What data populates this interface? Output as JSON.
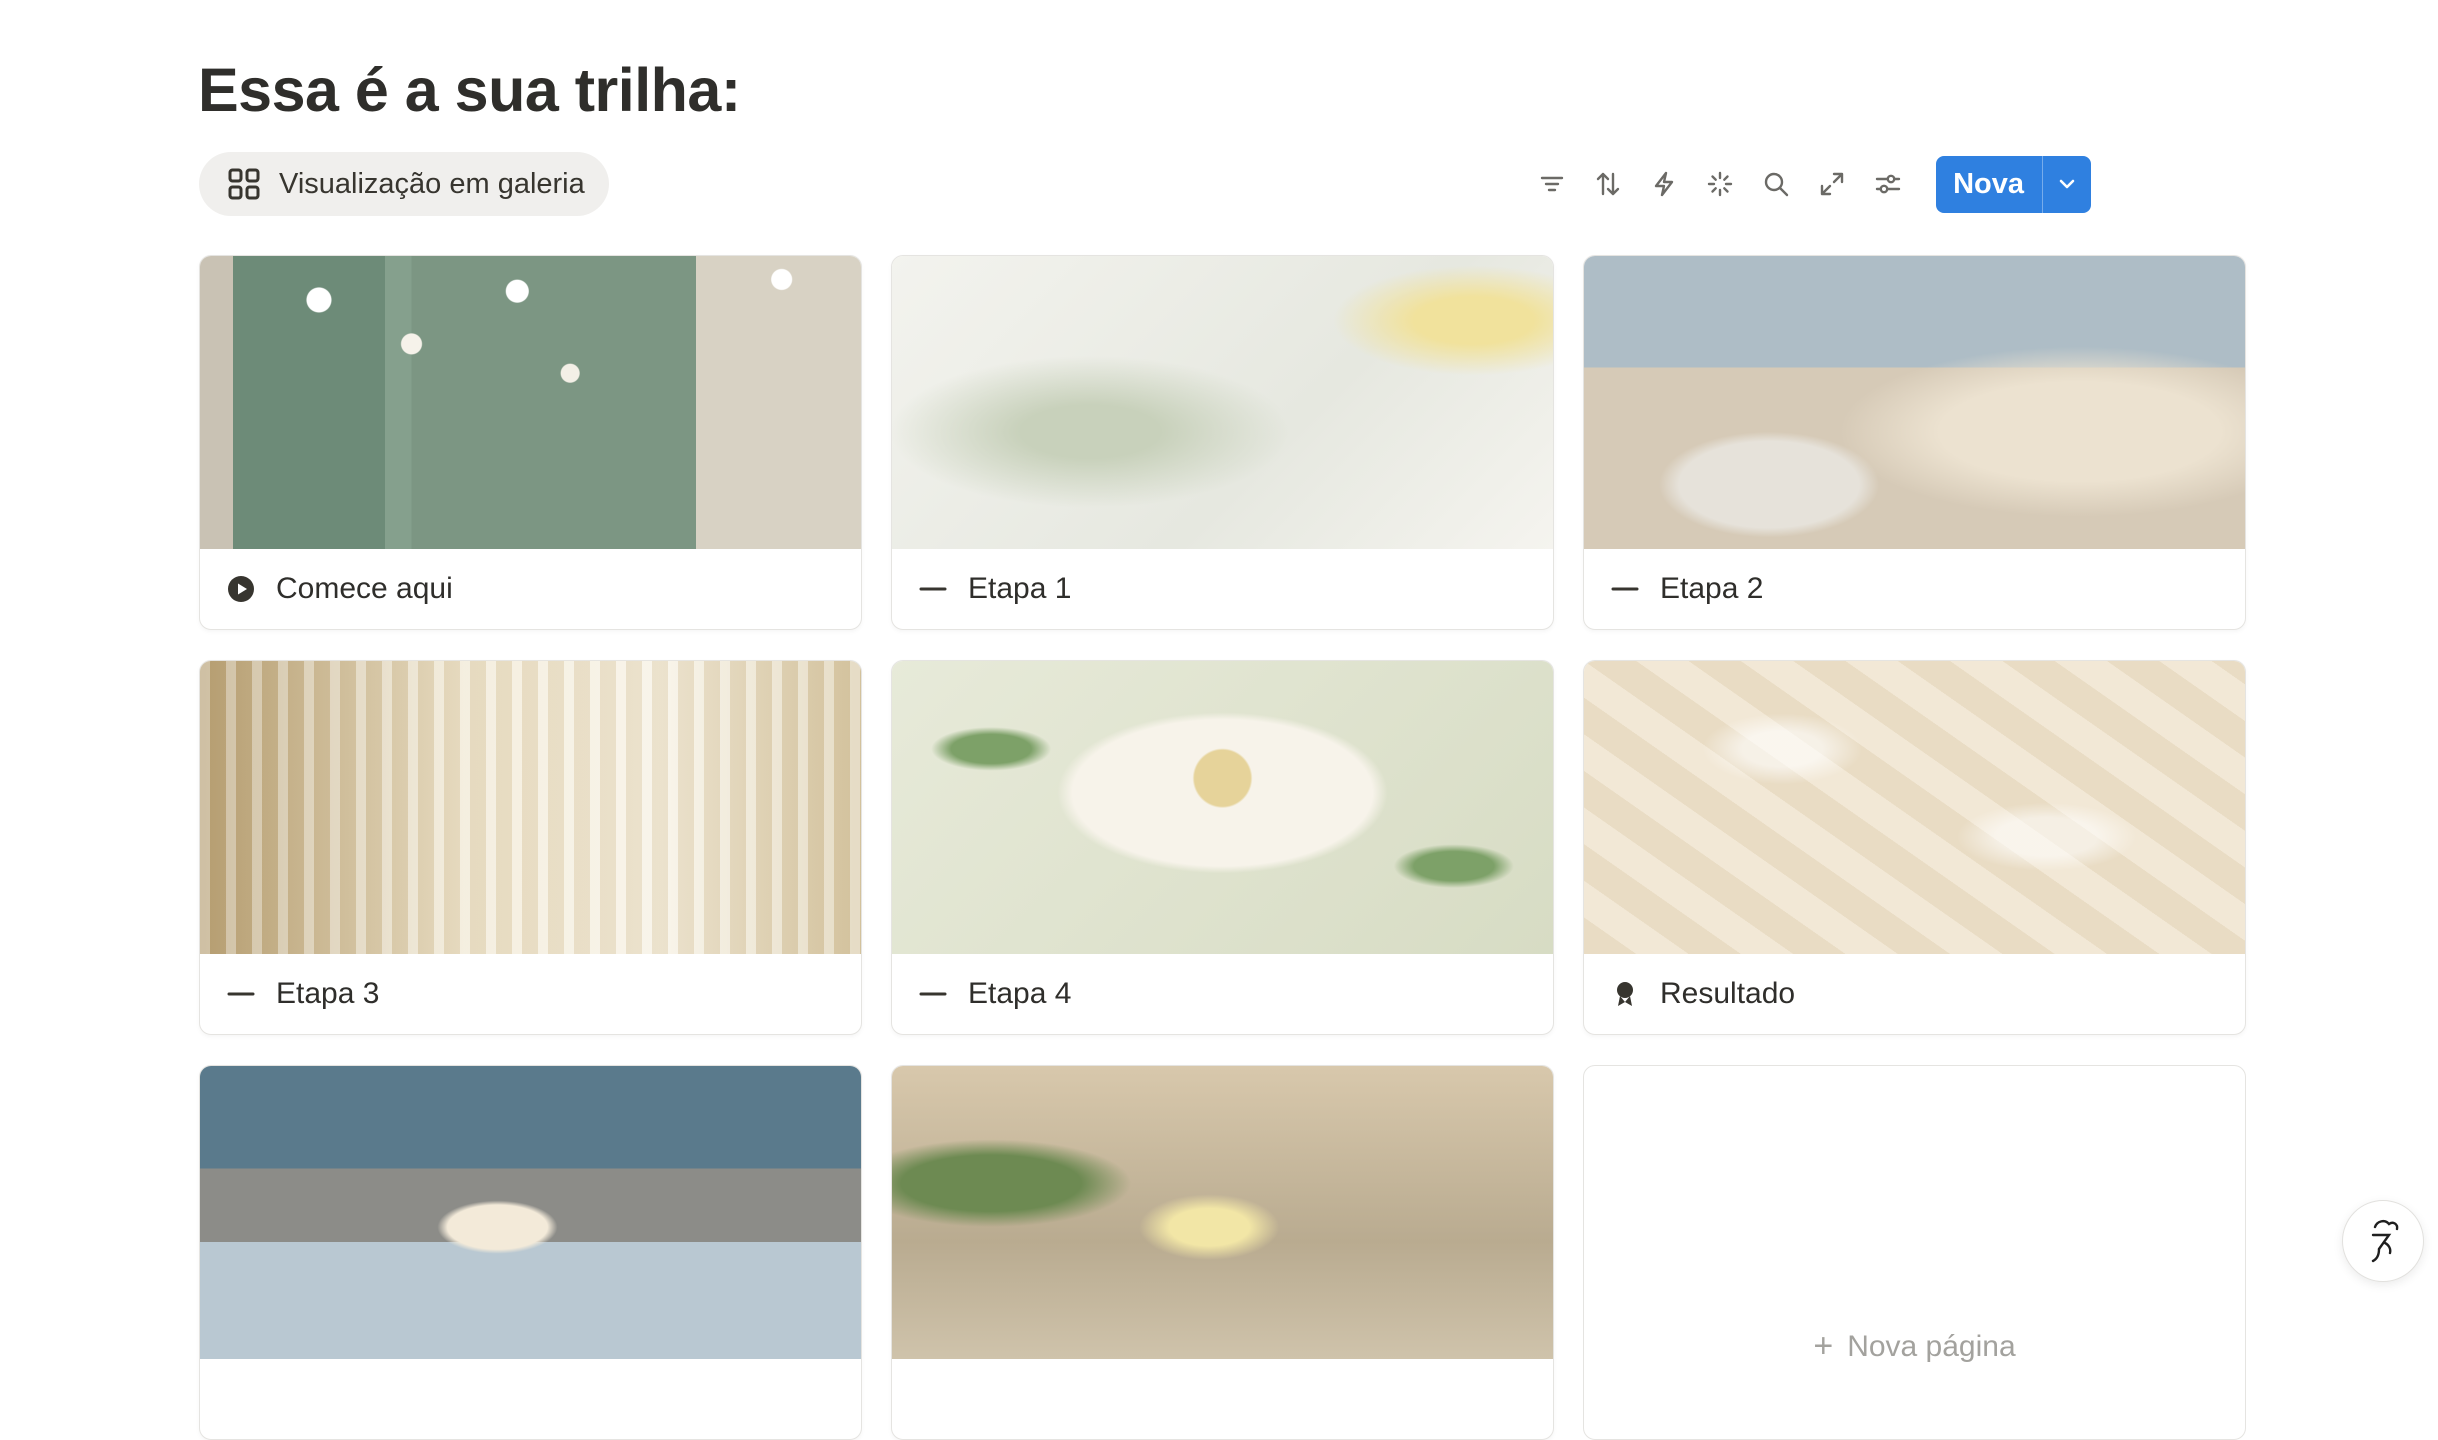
{
  "page": {
    "title": "Essa é a sua trilha:"
  },
  "view": {
    "label": "Visualização em galeria",
    "icon": "gallery-grid-icon"
  },
  "toolbar": {
    "tools": [
      "filter-icon",
      "sort-icon",
      "automation-bolt-icon",
      "ai-sparkle-icon",
      "search-icon",
      "expand-icon",
      "settings-sliders-icon"
    ],
    "new_label": "Nova",
    "accent": "#2f80e0"
  },
  "cards": [
    {
      "title": "Comece aqui",
      "icon": "play-circle-icon"
    },
    {
      "title": "Etapa 1",
      "icon": "dash-icon"
    },
    {
      "title": "Etapa 2",
      "icon": "dash-icon"
    },
    {
      "title": "Etapa 3",
      "icon": "dash-icon"
    },
    {
      "title": "Etapa 4",
      "icon": "dash-icon"
    },
    {
      "title": "Resultado",
      "icon": "award-ribbon-icon"
    },
    {
      "title": ""
    },
    {
      "title": ""
    }
  ],
  "new_page": {
    "label": "Nova página"
  }
}
